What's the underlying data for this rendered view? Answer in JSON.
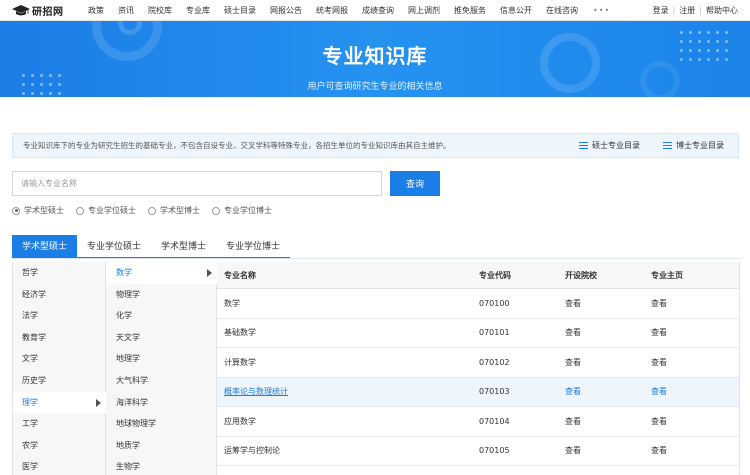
{
  "nav": {
    "logo_text": "研招网",
    "items": [
      "政策",
      "资讯",
      "院校库",
      "专业库",
      "硕士目录",
      "网报公告",
      "统考网报",
      "成绩查询",
      "网上调剂",
      "推免服务",
      "信息公开",
      "在线咨询"
    ],
    "more": "•••",
    "right": {
      "login": "登录",
      "register": "注册",
      "help": "帮助中心",
      "sep": "|"
    }
  },
  "banner": {
    "title": "专业知识库",
    "subtitle": "用户可查询研究生专业的相关信息"
  },
  "notice": {
    "text": "专业知识库下的专业为研究生招生的基础专业，不包含自设专业、交叉学科等特殊专业，各招生单位的专业知识库由其自主维护。",
    "link_master": "硕士专业目录",
    "link_doctor": "博士专业目录"
  },
  "search": {
    "placeholder": "请输入专业名称",
    "value": "",
    "button": "查询",
    "radios": [
      {
        "label": "学术型硕士",
        "checked": true
      },
      {
        "label": "专业学位硕士",
        "checked": false
      },
      {
        "label": "学术型博士",
        "checked": false
      },
      {
        "label": "专业学位博士",
        "checked": false
      }
    ]
  },
  "tabs": [
    {
      "label": "学术型硕士",
      "active": true
    },
    {
      "label": "专业学位硕士",
      "active": false
    },
    {
      "label": "学术型博士",
      "active": false
    },
    {
      "label": "专业学位博士",
      "active": false
    }
  ],
  "categories": [
    {
      "label": "哲学",
      "active": false
    },
    {
      "label": "经济学",
      "active": false
    },
    {
      "label": "法学",
      "active": false
    },
    {
      "label": "教育学",
      "active": false
    },
    {
      "label": "文学",
      "active": false
    },
    {
      "label": "历史学",
      "active": false
    },
    {
      "label": "理学",
      "active": true
    },
    {
      "label": "工学",
      "active": false
    },
    {
      "label": "农学",
      "active": false
    },
    {
      "label": "医学",
      "active": false
    }
  ],
  "subcategories": [
    {
      "label": "数学",
      "active": true
    },
    {
      "label": "物理学",
      "active": false
    },
    {
      "label": "化学",
      "active": false
    },
    {
      "label": "天文学",
      "active": false
    },
    {
      "label": "地理学",
      "active": false
    },
    {
      "label": "大气科学",
      "active": false
    },
    {
      "label": "海洋科学",
      "active": false
    },
    {
      "label": "地球物理学",
      "active": false
    },
    {
      "label": "地质学",
      "active": false
    },
    {
      "label": "生物学",
      "active": false
    }
  ],
  "table": {
    "headers": {
      "name": "专业名称",
      "code": "专业代码",
      "school": "开设院校",
      "home": "专业主页"
    },
    "rows": [
      {
        "name": "数学",
        "code": "070100",
        "school": "查看",
        "home": "查看",
        "highlight": false
      },
      {
        "name": "基础数学",
        "code": "070101",
        "school": "查看",
        "home": "查看",
        "highlight": false
      },
      {
        "name": "计算数学",
        "code": "070102",
        "school": "查看",
        "home": "查看",
        "highlight": false
      },
      {
        "name": "概率论与数理统计",
        "code": "070103",
        "school": "查看",
        "home": "查看",
        "highlight": true
      },
      {
        "name": "应用数学",
        "code": "070104",
        "school": "查看",
        "home": "查看",
        "highlight": false
      },
      {
        "name": "运筹学与控制论",
        "code": "070105",
        "school": "查看",
        "home": "查看",
        "highlight": false
      }
    ]
  },
  "colors": {
    "accent": "#1b7de6",
    "highlight_row": "#eef5fd"
  }
}
